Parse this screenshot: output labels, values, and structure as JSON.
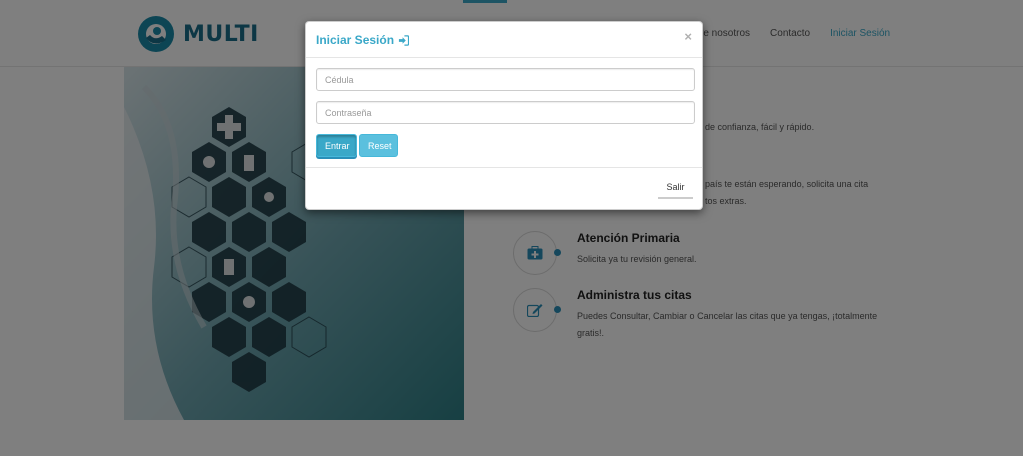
{
  "navbar": {
    "brand": "MULTI",
    "links": [
      "re nosotros",
      "Contacto",
      "Iniciar Sesión"
    ]
  },
  "features": [
    {
      "desc_fragment": "de confianza, fácil y rápido."
    },
    {
      "desc_fragment_1": "país te están esperando, solicita una cita",
      "desc_fragment_2": "tos extras."
    },
    {
      "title": "Atención Primaria",
      "desc": "Solicita ya tu revisión general.",
      "icon": "medical-kit-icon"
    },
    {
      "title": "Administra tus citas",
      "desc": "Puedes Consultar, Cambiar o Cancelar las citas que ya tengas, ¡totalmente gratis!.",
      "icon": "edit-icon"
    }
  ],
  "modal": {
    "title": "Iniciar Sesión",
    "close": "×",
    "cedula_placeholder": "Cédula",
    "password_placeholder": "Contraseña",
    "enter_label": "Entrar",
    "reset_label": "Reset",
    "exit_label": "Salir"
  },
  "colors": {
    "accent": "#3aa8c8",
    "brand": "#1a6e8a",
    "button": "#5bc0de"
  }
}
